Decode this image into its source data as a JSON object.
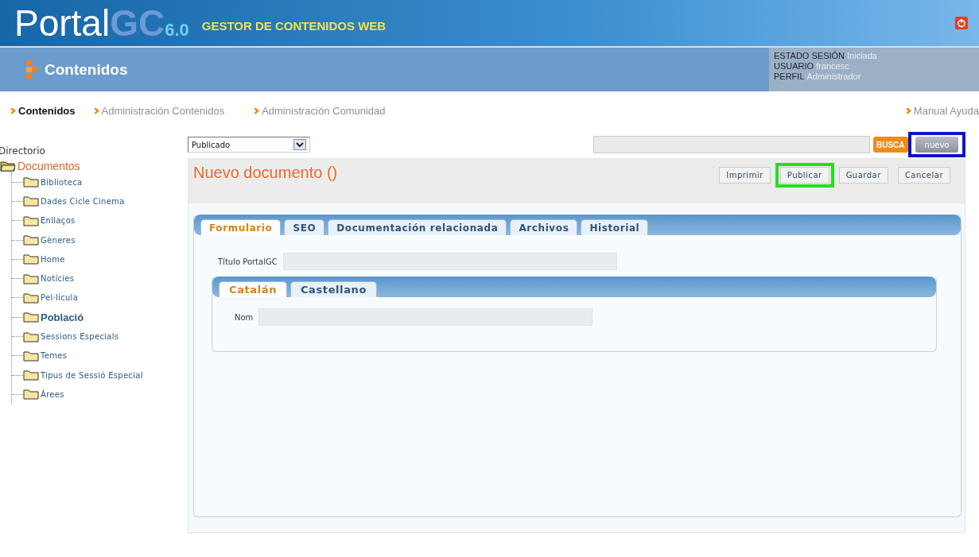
{
  "header": {
    "logo_main": "Portal",
    "logo_accent": "GC",
    "version": "6.0",
    "tagline": "GESTOR DE CONTENIDOS WEB"
  },
  "section": {
    "title": "Contenidos"
  },
  "session": [
    {
      "label": "ESTADO SESIÓN",
      "value": "Iniciada"
    },
    {
      "label": "USUARIO",
      "value": "francesc"
    },
    {
      "label": "PERFIL",
      "value": "Administrador"
    }
  ],
  "nav": [
    {
      "label": "Contenidos",
      "selected": true
    },
    {
      "label": "Administración Contenidos",
      "selected": false
    },
    {
      "label": "Administración Comunidad",
      "selected": false
    }
  ],
  "help_link": "Manual Ayuda",
  "sidebar": {
    "title": "Directorio",
    "tree": {
      "label": "Documentos",
      "expanded": true,
      "children": [
        {
          "label": "Biblioteca",
          "selected": false
        },
        {
          "label": "Dades Cicle Cinema",
          "selected": false
        },
        {
          "label": "Enllaços",
          "selected": false
        },
        {
          "label": "Gèneres",
          "selected": false
        },
        {
          "label": "Home",
          "selected": false
        },
        {
          "label": "Notícies",
          "selected": false
        },
        {
          "label": "Pel·lícula",
          "selected": false
        },
        {
          "label": "Població",
          "selected": true
        },
        {
          "label": "Sessions Especials",
          "selected": false
        },
        {
          "label": "Temes",
          "selected": false
        },
        {
          "label": "Tipus de Sessió Especial",
          "selected": false
        },
        {
          "label": "Àrees",
          "selected": false
        }
      ]
    }
  },
  "status_select": {
    "value": "Publicado"
  },
  "search_button": "BUSCA",
  "new_button": {
    "label": "nuevo",
    "highlighted": true
  },
  "document": {
    "title": "Nuevo documento ()"
  },
  "actions": [
    {
      "label": "Imprimir"
    },
    {
      "label": "Publicar",
      "highlighted": true
    },
    {
      "label": "Guardar"
    },
    {
      "label": "Cancelar"
    }
  ],
  "tabs": [
    {
      "label": "Formulario",
      "selected": true
    },
    {
      "label": "SEO",
      "selected": false
    },
    {
      "label": "Documentación relacionada",
      "selected": false
    },
    {
      "label": "Archivos",
      "selected": false
    },
    {
      "label": "Historial",
      "selected": false
    }
  ],
  "title_field": {
    "label": "Título PortalGC"
  },
  "lang_tabs": [
    {
      "label": "Catalán",
      "selected": true
    },
    {
      "label": "Castellano",
      "selected": false
    }
  ],
  "name_field": {
    "label": "Nom"
  }
}
